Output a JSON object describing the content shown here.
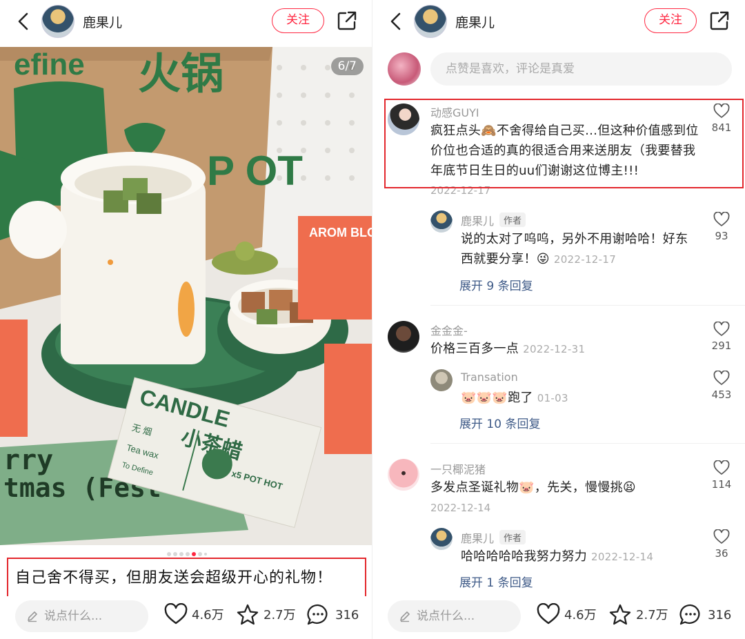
{
  "left": {
    "username": "鹿果儿",
    "follow_label": "关注",
    "image_counter": "6/7",
    "caption": "自己舍不得买，但朋友送会超级开心的礼物！",
    "input_placeholder": "说点什么...",
    "likes": "4.6万",
    "collects": "2.7万",
    "comments": "316",
    "carousel": {
      "total": 7,
      "active_index": 5
    },
    "photo_texts": {
      "box_brand": "efine",
      "box_title": "火锅",
      "box_side": "P OT",
      "tea_box_title": "小茶蜡",
      "tea_box_side": "CANDLE",
      "tea_box_tag": "无 烟",
      "tea_box_sub": "Tea wax",
      "tea_box_count": "x5 POT HOT",
      "tea_box_brand": "To Define",
      "aroma_box": "AROM BLOCK",
      "card_line1": "rry",
      "card_line2": "tmas (Fest"
    }
  },
  "right": {
    "username": "鹿果儿",
    "follow_label": "关注",
    "comment_placeholder": "点赞是喜欢，评论是真爱",
    "comments": [
      {
        "user": "动感GUYI",
        "text": "疯狂点头🙈不舍得给自己买…但这种价值感到位价位也合适的真的很适合用来送朋友（我要替我年底节日生日的uu们谢谢这位博主!!!",
        "date": "2022-12-17",
        "likes": "841",
        "reply": {
          "user": "鹿果儿",
          "badge": "作者",
          "text": "说的太对了呜呜，另外不用谢哈哈！好东西就要分享！😜",
          "date": "2022-12-17",
          "likes": "93"
        },
        "expand": "展开 9 条回复"
      },
      {
        "user": "金金金-",
        "text": "价格三百多一点",
        "date": "2022-12-31",
        "likes": "291",
        "reply": {
          "user": "Transation",
          "text": "🐷🐷🐷跑了",
          "date": "01-03",
          "likes": "453"
        },
        "expand": "展开 10 条回复"
      },
      {
        "user": "一只椰泥猪",
        "text": "多发点圣诞礼物🐷，先关，慢慢挑😫",
        "date": "2022-12-14",
        "likes": "114",
        "reply": {
          "user": "鹿果儿",
          "badge": "作者",
          "text": "哈哈哈哈哈我努力努力",
          "date": "2022-12-14",
          "likes": "36"
        },
        "expand": "展开 1 条回复"
      }
    ],
    "input_placeholder": "说点什么...",
    "likes": "4.6万",
    "collects": "2.7万",
    "comments_count": "316"
  },
  "colors": {
    "accent_red": "#ff2741",
    "highlight_border": "#e3262c",
    "link_blue": "#3e5a87"
  }
}
